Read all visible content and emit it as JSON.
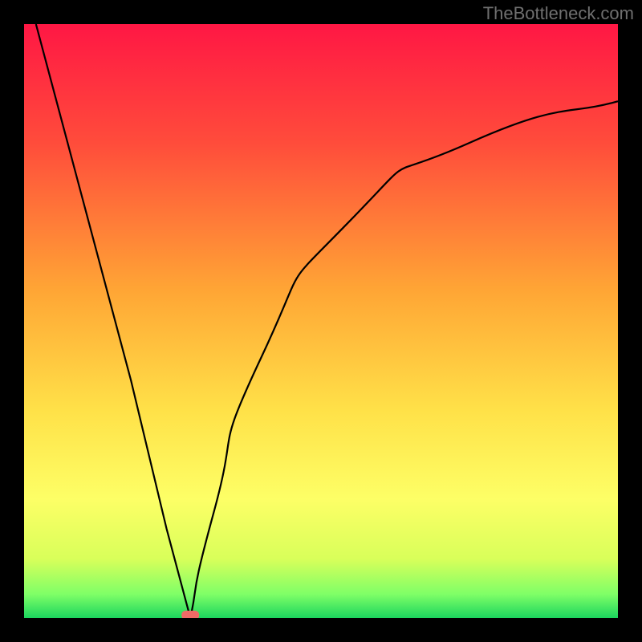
{
  "watermark": "TheBottleneck.com",
  "chart_data": {
    "type": "line",
    "description": "V-shaped bottleneck curve on a rainbow vertical gradient (red at top through orange, yellow, to green at bottom). The curve starts at the top-left, dips sharply to the bottom near x≈0.28, and rises asymptotically toward the right.",
    "x_range": [
      0,
      1
    ],
    "y_range": [
      0,
      1
    ],
    "curve": {
      "x_at_min": 0.28,
      "left_branch_approx": [
        {
          "x": 0.02,
          "y": 1.0
        },
        {
          "x": 0.1,
          "y": 0.7
        },
        {
          "x": 0.18,
          "y": 0.4
        },
        {
          "x": 0.24,
          "y": 0.15
        },
        {
          "x": 0.28,
          "y": 0.0
        }
      ],
      "right_branch_approx": [
        {
          "x": 0.28,
          "y": 0.0
        },
        {
          "x": 0.32,
          "y": 0.18
        },
        {
          "x": 0.4,
          "y": 0.44
        },
        {
          "x": 0.55,
          "y": 0.67
        },
        {
          "x": 0.75,
          "y": 0.8
        },
        {
          "x": 1.0,
          "y": 0.87
        }
      ]
    },
    "marker": {
      "x": 0.28,
      "y": 0.0,
      "color": "#ef6a66",
      "shape": "rounded-rect"
    },
    "gradient_stops": [
      {
        "offset": 0.0,
        "color": "#ff1744"
      },
      {
        "offset": 0.2,
        "color": "#ff4c3b"
      },
      {
        "offset": 0.45,
        "color": "#ffa635"
      },
      {
        "offset": 0.65,
        "color": "#ffe148"
      },
      {
        "offset": 0.8,
        "color": "#fdff66"
      },
      {
        "offset": 0.9,
        "color": "#d9ff5a"
      },
      {
        "offset": 0.96,
        "color": "#7fff67"
      },
      {
        "offset": 1.0,
        "color": "#1cd65e"
      }
    ],
    "title": "",
    "xlabel": "",
    "ylabel": "",
    "grid": false
  }
}
